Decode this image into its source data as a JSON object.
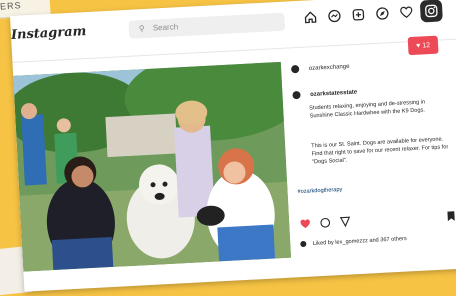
{
  "brand": {
    "logo_text": "Instagram",
    "accent": "#ed4956",
    "card_bg": "#ffffff",
    "backdrop": "#f6c344"
  },
  "scrap": {
    "text": "ERS"
  },
  "search": {
    "placeholder": "Search",
    "icon": "search-icon"
  },
  "nav": {
    "icons": [
      "home-icon",
      "messenger-icon",
      "new-post-icon",
      "explore-icon",
      "heart-icon",
      "instagram-icon"
    ]
  },
  "notification": {
    "icon": "heart-icon",
    "count": "12"
  },
  "post": {
    "top_username": "ozarkexchange",
    "author": "ozarkstatesstate",
    "caption": "Students relaxing, enjoying and de-stressing in Sunshine Classic Hardwhee with the K9 Dogs.",
    "caption_more": "This is our St. Saint. Dogs are available for everyone. Find that right to save for our recent relaxer. For tips for \"Dogs Social\".",
    "hashtags": "#ozarkdogtherapy",
    "likes_text": "Liked by lex_gomezzz and 367 others"
  }
}
